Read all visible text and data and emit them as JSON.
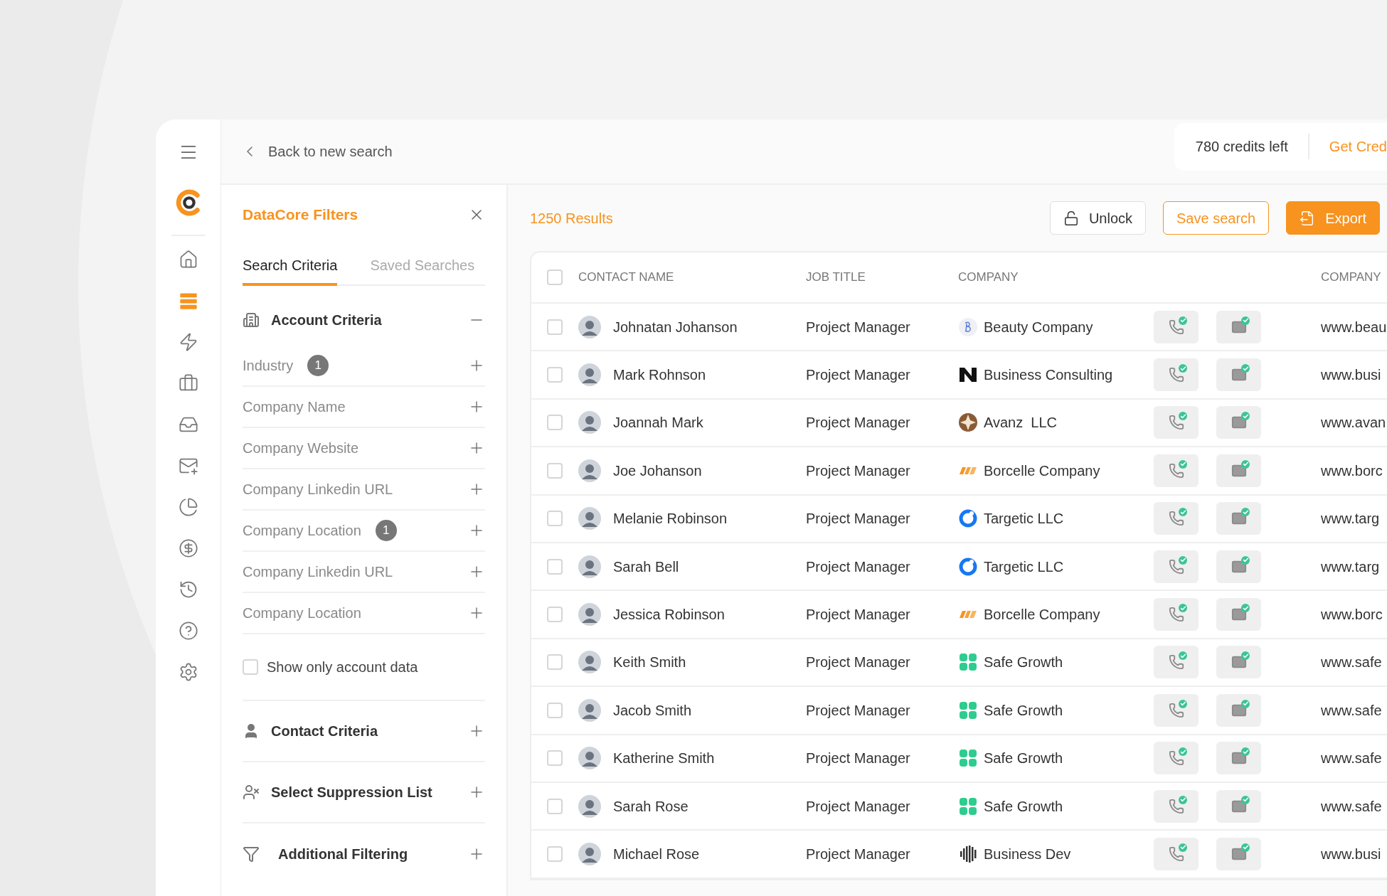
{
  "sidebar": {
    "items": [
      {
        "selected": false
      },
      {
        "selected": true
      },
      {
        "selected": false
      },
      {
        "selected": false
      },
      {
        "selected": false
      },
      {
        "selected": false
      },
      {
        "selected": false
      },
      {
        "selected": false
      },
      {
        "selected": false
      },
      {
        "selected": false
      },
      {
        "selected": false
      }
    ]
  },
  "header": {
    "back_label": "Back to new search",
    "credits": "780 credits left",
    "get_credits": "Get Cred"
  },
  "filters": {
    "title": "DataCore Filters",
    "tabs": [
      {
        "label": "Search Criteria",
        "selected": true
      },
      {
        "label": "Saved Searches",
        "selected": false
      }
    ],
    "account_criteria": {
      "title": "Account Criteria",
      "expanded": true,
      "fields": [
        {
          "label": "Industry",
          "count": "1"
        },
        {
          "label": "Company Name"
        },
        {
          "label": "Company Website"
        },
        {
          "label": "Company Linkedin URL"
        },
        {
          "label": "Company Location",
          "count": "1"
        },
        {
          "label": "Company Linkedin URL"
        },
        {
          "label": "Company Location"
        }
      ],
      "account_only": {
        "label": "Show only account data",
        "checked": false
      }
    },
    "sections": [
      {
        "kind": "contact",
        "title": "Contact Criteria",
        "expanded": false
      },
      {
        "kind": "suppression",
        "title": "Select Suppression List",
        "expanded": false
      },
      {
        "kind": "filter",
        "title": "Additional Filtering",
        "expanded": false
      }
    ]
  },
  "results": {
    "count": "1250 Results",
    "buttons": [
      {
        "kind": "unlock",
        "label": "Unlock"
      },
      {
        "kind": "save",
        "label": "Save search"
      },
      {
        "kind": "export",
        "label": "Export"
      }
    ]
  },
  "table": {
    "all_checked": false,
    "columns": [
      "CONTACT NAME",
      "JOB TITLE",
      "COMPANY",
      "COMPANY"
    ],
    "rows": [
      {
        "selected": false,
        "name": "Johnatan Johanson",
        "job_title": "Project Manager",
        "company": {
          "kind": "curl",
          "name": "Beauty Company"
        },
        "phone_verified": true,
        "email_verified": true,
        "website": "www.beau"
      },
      {
        "selected": false,
        "name": "Mark Rohnson",
        "job_title": "Project Manager",
        "company": {
          "kind": "zigzag",
          "name": "Business Consulting"
        },
        "phone_verified": true,
        "email_verified": true,
        "website": "www.busi"
      },
      {
        "selected": false,
        "name": "Joannah Mark",
        "job_title": "Project Manager",
        "company": {
          "kind": "compass",
          "name": "Avanz  LLC"
        },
        "phone_verified": true,
        "email_verified": true,
        "website": "www.avan"
      },
      {
        "selected": false,
        "name": "Joe Johanson",
        "job_title": "Project Manager",
        "company": {
          "kind": "stripes",
          "name": "Borcelle Company"
        },
        "phone_verified": true,
        "email_verified": true,
        "website": "www.borc"
      },
      {
        "selected": false,
        "name": "Melanie Robinson",
        "job_title": "Project Manager",
        "company": {
          "kind": "ring",
          "name": "Targetic LLC"
        },
        "phone_verified": true,
        "email_verified": true,
        "website": "www.targ"
      },
      {
        "selected": false,
        "name": "Sarah Bell",
        "job_title": "Project Manager",
        "company": {
          "kind": "ring",
          "name": "Targetic LLC"
        },
        "phone_verified": true,
        "email_verified": true,
        "website": "www.targ"
      },
      {
        "selected": false,
        "name": "Jessica Robinson",
        "job_title": "Project Manager",
        "company": {
          "kind": "stripes",
          "name": "Borcelle Company"
        },
        "phone_verified": true,
        "email_verified": true,
        "website": "www.borc"
      },
      {
        "selected": false,
        "name": "Keith Smith",
        "job_title": "Project Manager",
        "company": {
          "kind": "clover",
          "name": "Safe Growth"
        },
        "phone_verified": true,
        "email_verified": true,
        "website": "www.safe"
      },
      {
        "selected": false,
        "name": "Jacob Smith",
        "job_title": "Project Manager",
        "company": {
          "kind": "clover",
          "name": "Safe Growth"
        },
        "phone_verified": true,
        "email_verified": true,
        "website": "www.safe"
      },
      {
        "selected": false,
        "name": "Katherine Smith",
        "job_title": "Project Manager",
        "company": {
          "kind": "clover",
          "name": "Safe Growth"
        },
        "phone_verified": true,
        "email_verified": true,
        "website": "www.safe"
      },
      {
        "selected": false,
        "name": "Sarah Rose",
        "job_title": "Project Manager",
        "company": {
          "kind": "clover",
          "name": "Safe Growth"
        },
        "phone_verified": true,
        "email_verified": true,
        "website": "www.safe"
      },
      {
        "selected": false,
        "name": "Michael Rose",
        "job_title": "Project Manager",
        "company": {
          "kind": "wave",
          "name": "Business Dev"
        },
        "phone_verified": true,
        "email_verified": true,
        "website": "www.busi"
      }
    ]
  }
}
